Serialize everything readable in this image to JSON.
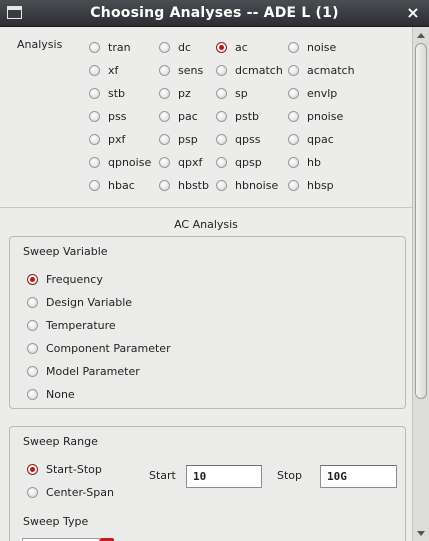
{
  "window": {
    "title": "Choosing Analyses -- ADE L (1)",
    "close_glyph": "×"
  },
  "analysis": {
    "label": "Analysis",
    "selected": "ac",
    "columns": [
      [
        "tran",
        "xf",
        "stb",
        "pss",
        "pxf",
        "qpnoise",
        "hbac"
      ],
      [
        "dc",
        "sens",
        "pz",
        "pac",
        "psp",
        "qpxf",
        "hbstb"
      ],
      [
        "ac",
        "dcmatch",
        "sp",
        "pstb",
        "qpss",
        "qpsp",
        "hbnoise"
      ],
      [
        "noise",
        "acmatch",
        "envlp",
        "pnoise",
        "qpac",
        "hb",
        "hbsp"
      ]
    ]
  },
  "ac_analysis": {
    "heading": "AC Analysis",
    "sweep_variable": {
      "title": "Sweep Variable",
      "selected": "Frequency",
      "options": [
        "Frequency",
        "Design Variable",
        "Temperature",
        "Component Parameter",
        "Model Parameter",
        "None"
      ]
    },
    "sweep_range": {
      "title": "Sweep Range",
      "selected": "Start-Stop",
      "options": [
        "Start-Stop",
        "Center-Span"
      ],
      "start_label": "Start",
      "start_value": "10",
      "stop_label": "Stop",
      "stop_value": "10G",
      "sweep_type_label": "Sweep Type"
    }
  },
  "colors": {
    "accent": "#c0141b",
    "titlebar": "#2c2e31"
  }
}
